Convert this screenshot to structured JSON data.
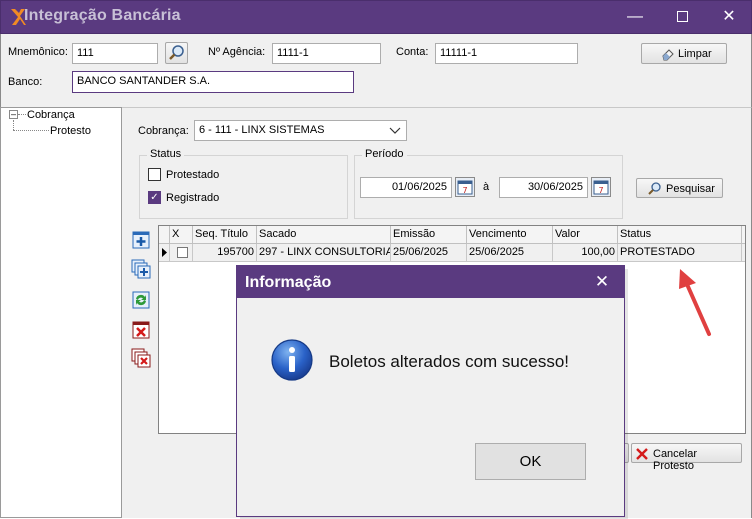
{
  "window": {
    "title": "Integração Bancária",
    "accent_color": "#5a3a80",
    "controls": [
      "minimize-icon",
      "maximize-icon",
      "close-icon"
    ]
  },
  "form": {
    "mnemonico_label": "Mnemônico:",
    "mnemonico_value": "111",
    "agencia_label": "Nº Agência:",
    "agencia_value": "1111-1",
    "conta_label": "Conta:",
    "conta_value": "11111-1",
    "banco_label": "Banco:",
    "banco_value": "BANCO SANTANDER S.A.",
    "limpar_label": "Limpar"
  },
  "tree": {
    "root": "Cobrança",
    "child": "Protesto"
  },
  "filters": {
    "cobranca_label": "Cobrança:",
    "cobranca_value": "6 - 111 - LINX SISTEMAS",
    "status_legend": "Status",
    "status_options": [
      {
        "label": "Protestado",
        "checked": false
      },
      {
        "label": "Registrado",
        "checked": true
      }
    ],
    "periodo_legend": "Período",
    "periodo_from": "01/06/2025",
    "periodo_sep": "à",
    "periodo_to": "30/06/2025",
    "pesquisar_label": "Pesquisar"
  },
  "grid": {
    "columns": [
      "X",
      "Seq. Título",
      "Sacado",
      "Emissão",
      "Vencimento",
      "Valor",
      "Status"
    ],
    "rows": [
      {
        "checked": false,
        "seq_titulo": "195700",
        "sacado": "297 - LINX CONSULTORIA",
        "emissao": "25/06/2025",
        "vencimento": "25/06/2025",
        "valor": "100,00",
        "status": "PROTESTADO"
      }
    ]
  },
  "actions": {
    "cancelar_protesto_label": "Cancelar Protesto",
    "side_icons": [
      "add-icon",
      "copy-add-icon",
      "refresh-icon",
      "delete-icon",
      "delete-multiple-icon"
    ]
  },
  "dialog": {
    "title": "Informação",
    "message": "Boletos alterados com sucesso!",
    "ok_label": "OK",
    "icon": "info-icon"
  },
  "annotation": {
    "arrow_color": "#e04040"
  }
}
